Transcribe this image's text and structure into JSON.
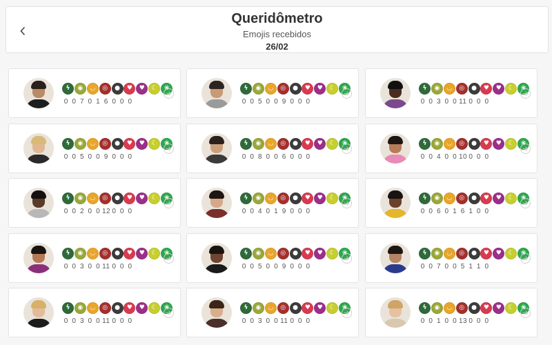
{
  "header": {
    "title": "Queridômetro",
    "subtitle": "Emojis recebidos",
    "date": "26/02"
  },
  "emoji_icons": [
    {
      "name": "snake-icon",
      "glyph": "ϟ",
      "color": "#2f6b3a"
    },
    {
      "name": "vomit-icon",
      "glyph": "◉",
      "color": "#9aa83a"
    },
    {
      "name": "smiley-icon",
      "glyph": "◡",
      "color": "#e8a62b"
    },
    {
      "name": "bullseye-icon",
      "glyph": "◎",
      "color": "#a3302d"
    },
    {
      "name": "bomb-icon",
      "glyph": "●",
      "color": "#3c3c3c"
    },
    {
      "name": "heart-icon",
      "glyph": "♥",
      "color": "#d83b50"
    },
    {
      "name": "broken-heart-icon",
      "glyph": "♥",
      "color": "#9b2f8a"
    },
    {
      "name": "banana-icon",
      "glyph": "☾",
      "color": "#c7cf2e"
    },
    {
      "name": "plant-icon",
      "glyph": "❀",
      "color": "#2ea84e"
    }
  ],
  "participants": [
    {
      "counts": [
        "0",
        "0",
        "7",
        "0",
        "1",
        "6",
        "0",
        "0",
        "0"
      ],
      "skin": "#b98a66",
      "hair": "#2a211b",
      "shirt": "#1d1d1d"
    },
    {
      "counts": [
        "0",
        "0",
        "5",
        "0",
        "0",
        "9",
        "0",
        "0",
        "0"
      ],
      "skin": "#c99a74",
      "hair": "#2b2420",
      "shirt": "#9a9a9a"
    },
    {
      "counts": [
        "0",
        "0",
        "3",
        "0",
        "0",
        "11",
        "0",
        "0",
        "0"
      ],
      "skin": "#4a2d1f",
      "hair": "#111111",
      "shirt": "#7b4a8c"
    },
    {
      "counts": [
        "0",
        "0",
        "5",
        "0",
        "0",
        "9",
        "0",
        "0",
        "0"
      ],
      "skin": "#e1b792",
      "hair": "#d9b978",
      "shirt": "#2a2a2a"
    },
    {
      "counts": [
        "0",
        "0",
        "8",
        "0",
        "0",
        "6",
        "0",
        "0",
        "0"
      ],
      "skin": "#caa07c",
      "hair": "#2b211a",
      "shirt": "#3a3a3a"
    },
    {
      "counts": [
        "0",
        "0",
        "4",
        "0",
        "0",
        "10",
        "0",
        "0",
        "0"
      ],
      "skin": "#b77b57",
      "hair": "#1d1714",
      "shirt": "#e88bb6"
    },
    {
      "counts": [
        "0",
        "0",
        "2",
        "0",
        "0",
        "12",
        "0",
        "0",
        "0"
      ],
      "skin": "#5b3a28",
      "hair": "#151010",
      "shirt": "#b8b8b8"
    },
    {
      "counts": [
        "0",
        "0",
        "4",
        "0",
        "1",
        "9",
        "0",
        "0",
        "0"
      ],
      "skin": "#d7a888",
      "hair": "#1e1612",
      "shirt": "#7a2f2a"
    },
    {
      "counts": [
        "0",
        "0",
        "6",
        "0",
        "1",
        "6",
        "1",
        "0",
        "0"
      ],
      "skin": "#6a412a",
      "hair": "#191311",
      "shirt": "#e3b62b"
    },
    {
      "counts": [
        "0",
        "0",
        "3",
        "0",
        "0",
        "11",
        "0",
        "0",
        "0"
      ],
      "skin": "#b47a55",
      "hair": "#1a1411",
      "shirt": "#8c2f7a"
    },
    {
      "counts": [
        "0",
        "0",
        "5",
        "0",
        "0",
        "9",
        "0",
        "0",
        "0"
      ],
      "skin": "#6d4530",
      "hair": "#1a1411",
      "shirt": "#1a1a1a"
    },
    {
      "counts": [
        "0",
        "0",
        "7",
        "0",
        "0",
        "5",
        "1",
        "1",
        "0"
      ],
      "skin": "#b78463",
      "hair": "#1d1714",
      "shirt": "#2b3b8c"
    },
    {
      "counts": [
        "0",
        "0",
        "3",
        "0",
        "0",
        "11",
        "0",
        "0",
        "0"
      ],
      "skin": "#e2bc98",
      "hair": "#d7b06a",
      "shirt": "#1c1c1c"
    },
    {
      "counts": [
        "0",
        "0",
        "3",
        "0",
        "0",
        "11",
        "0",
        "0",
        "0"
      ],
      "skin": "#d9ae8c",
      "hair": "#3b2418",
      "shirt": "#4a2f2a"
    },
    {
      "counts": [
        "0",
        "0",
        "1",
        "0",
        "0",
        "13",
        "0",
        "0",
        "0"
      ],
      "skin": "#e6c2a0",
      "hair": "#cfa464",
      "shirt": "#d9c8b0"
    }
  ]
}
